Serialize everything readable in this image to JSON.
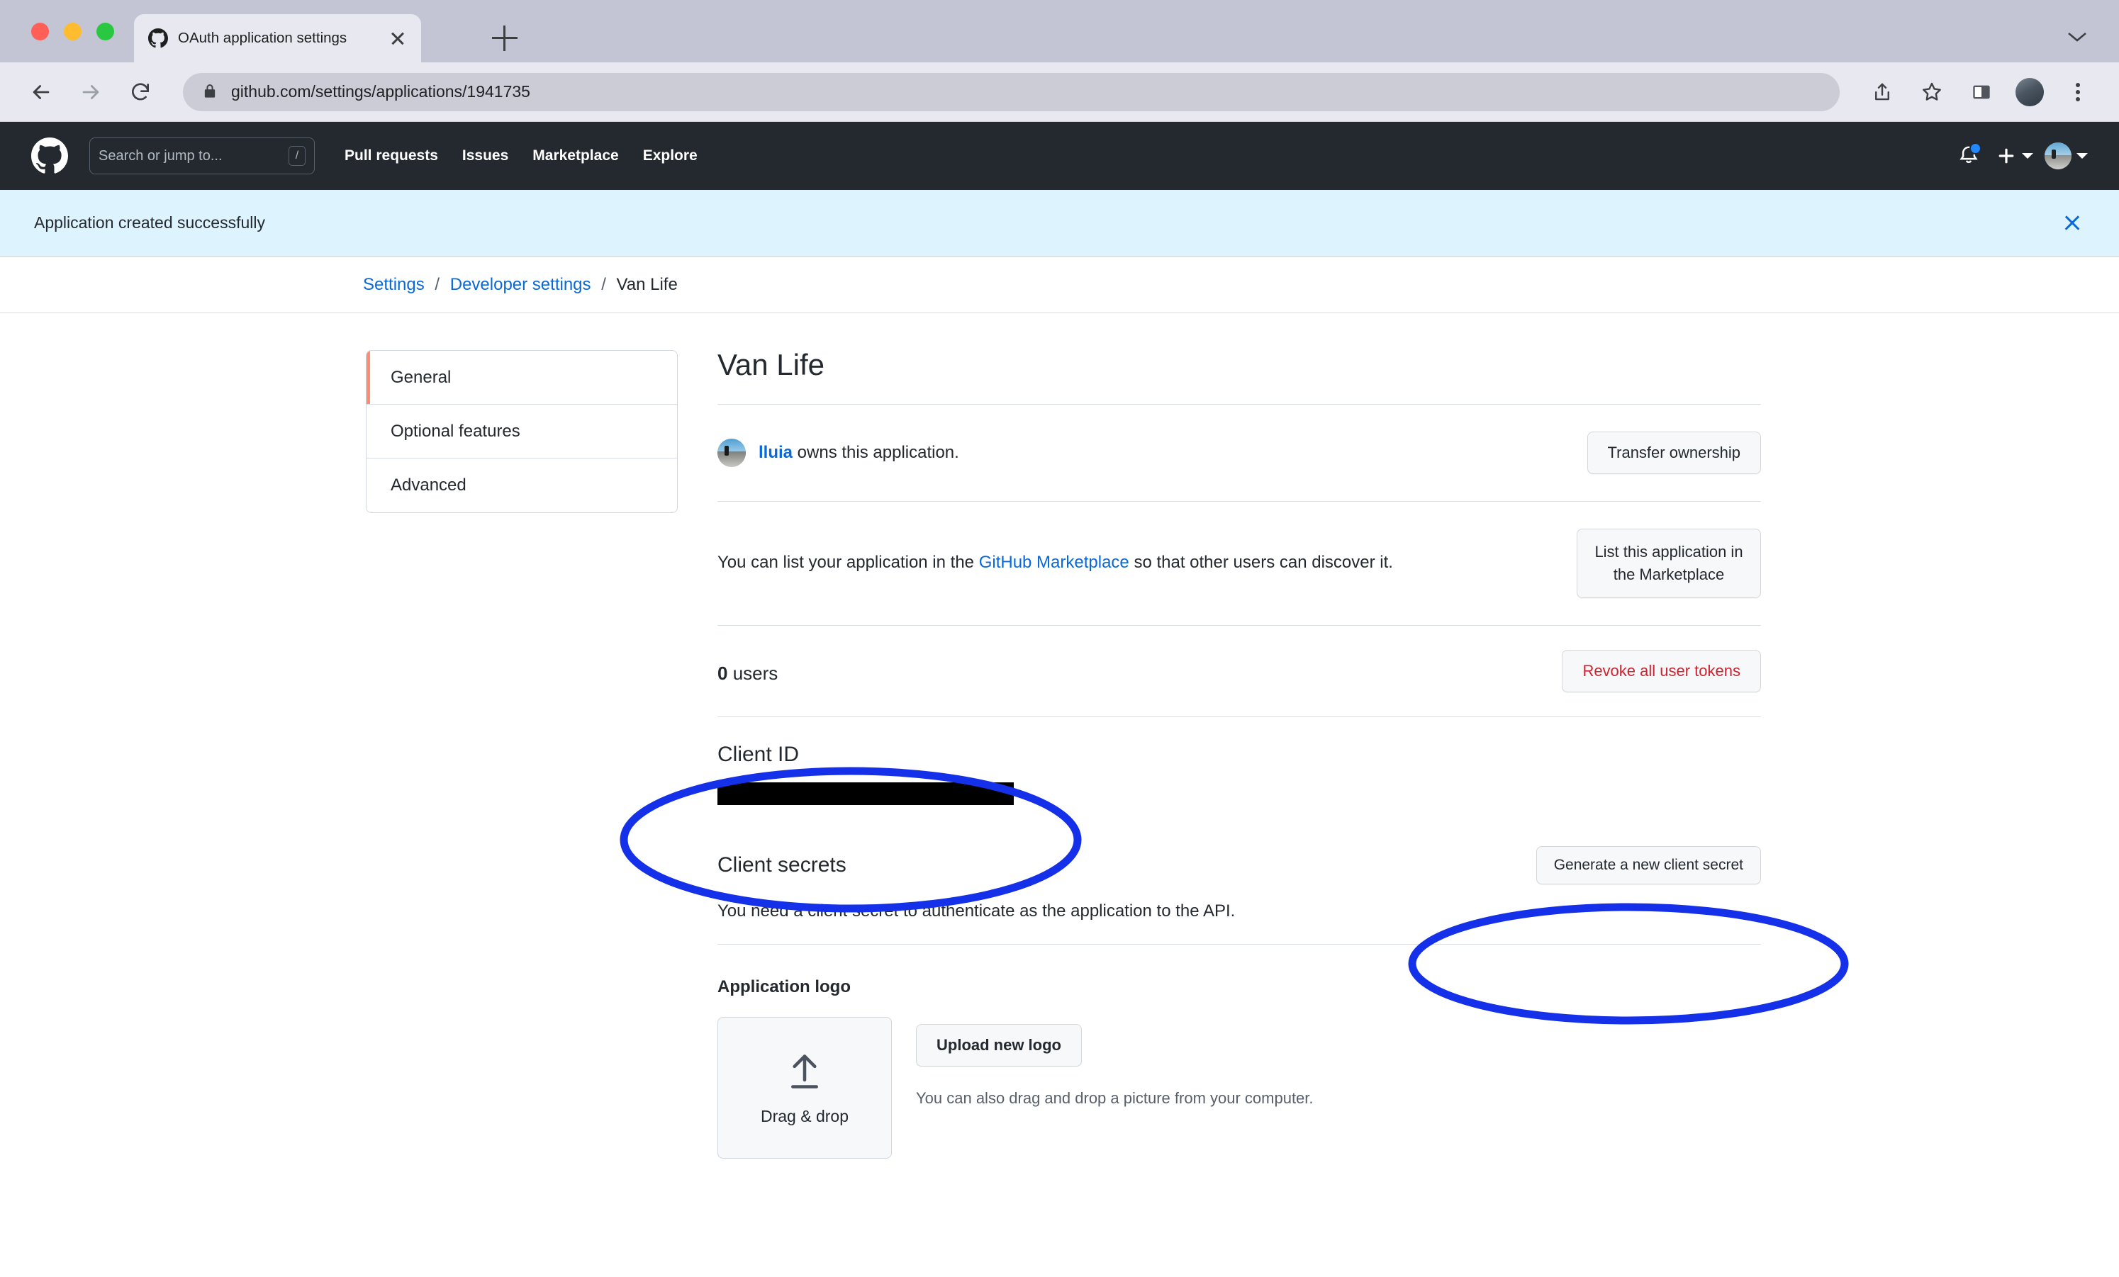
{
  "browser": {
    "tab": {
      "title": "OAuth application settings",
      "favicon": "github-icon",
      "close": "close-icon"
    },
    "new_tab": "new-tab-icon",
    "back": "back-arrow-icon",
    "forward": "forward-arrow-icon",
    "reload": "reload-icon",
    "url_secure_prefix": "github.com",
    "url_path": "/settings/applications/1941735",
    "url_full": "github.com/settings/applications/1941735",
    "lock": "lock-icon",
    "share": "share-icon",
    "bookmark": "star-icon",
    "sidepanel": "side-panel-icon",
    "profile": "profile-avatar",
    "menu": "three-dot-menu-icon"
  },
  "gh_header": {
    "logo": "github-mark-icon",
    "search_placeholder": "Search or jump to...",
    "search_shortcut": "/",
    "nav": [
      {
        "label": "Pull requests"
      },
      {
        "label": "Issues"
      },
      {
        "label": "Marketplace"
      },
      {
        "label": "Explore"
      }
    ],
    "notifications_icon": "bell-icon",
    "has_unread": true,
    "create_new_icon": "plus-icon",
    "account_icon": "user-avatar"
  },
  "flash": {
    "message": "Application created successfully",
    "dismiss": "close-icon"
  },
  "breadcrumb": {
    "items": [
      {
        "label": "Settings",
        "link": true
      },
      {
        "label": "Developer settings",
        "link": true
      },
      {
        "label": "Van Life",
        "link": false
      }
    ],
    "separator": "/"
  },
  "sidebar": {
    "items": [
      {
        "label": "General",
        "active": true
      },
      {
        "label": "Optional features",
        "active": false
      },
      {
        "label": "Advanced",
        "active": false
      }
    ]
  },
  "main": {
    "title": "Van Life",
    "owner": {
      "username": "lluia",
      "suffix": " owns this application.",
      "avatar": "owner-avatar"
    },
    "transfer_button": "Transfer ownership",
    "marketplace": {
      "text_before": "You can list your application in the ",
      "link": "GitHub Marketplace",
      "text_after": " so that other users can discover it.",
      "button": "List this application in the Marketplace"
    },
    "users": {
      "count": "0",
      "label": " users",
      "revoke_button": "Revoke all user tokens"
    },
    "client_id": {
      "heading": "Client ID",
      "value_redacted": true
    },
    "client_secrets": {
      "heading": "Client secrets",
      "description": "You need a client secret to authenticate as the application to the API.",
      "generate_button": "Generate a new client secret"
    },
    "application_logo": {
      "heading": "Application logo",
      "dropzone_label": "Drag & drop",
      "dropzone_icon": "upload-arrow-icon",
      "upload_button": "Upload new logo",
      "hint": "You can also drag and drop a picture from your computer."
    }
  },
  "annotations": {
    "color": "#1430e8",
    "shapes": [
      {
        "name": "client-id-highlight",
        "label": "Client ID"
      },
      {
        "name": "generate-secret-highlight",
        "label": "Generate a new client secret"
      }
    ]
  }
}
